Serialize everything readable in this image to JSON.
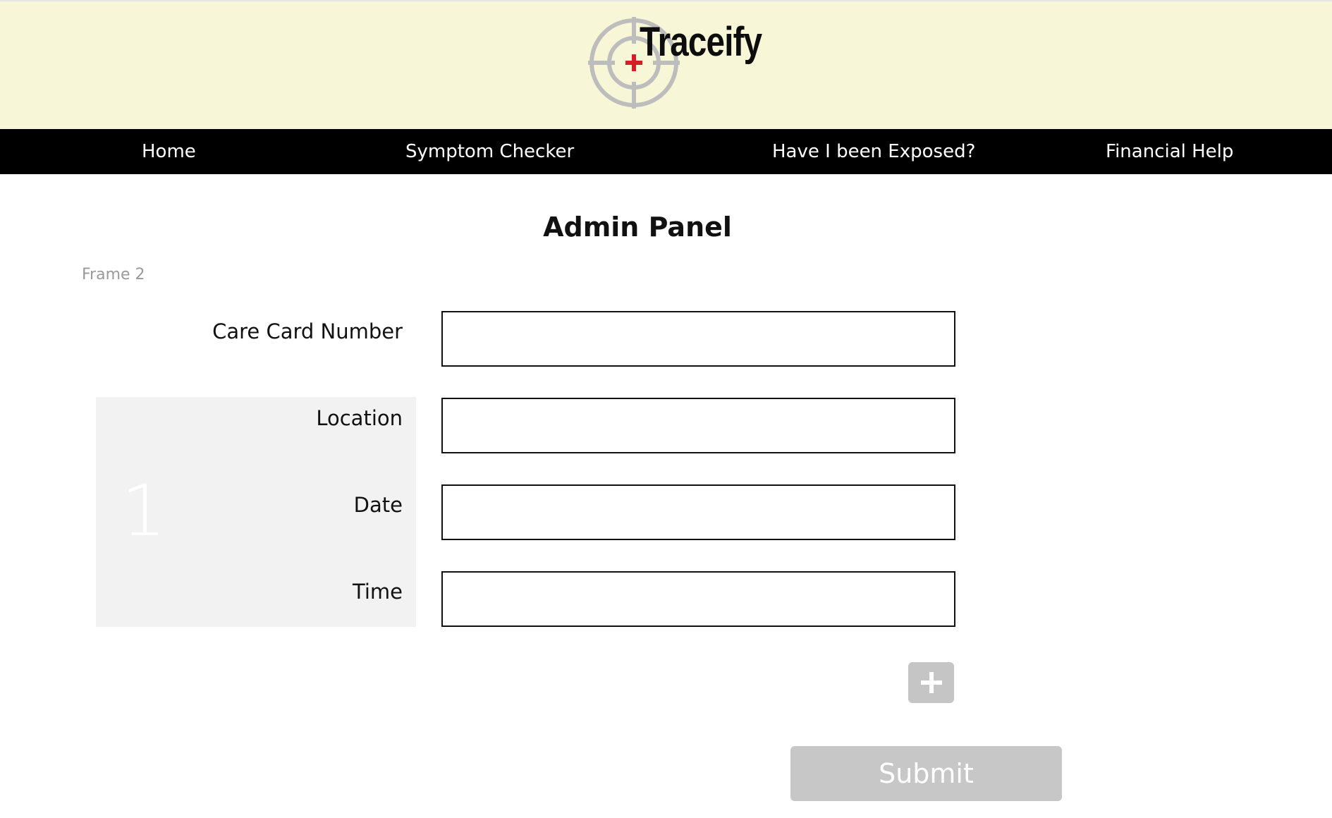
{
  "header": {
    "brand_name": "Traceify",
    "logo_icon": "crosshair-icon",
    "accent_color": "#d32027",
    "background_color": "#f7f7d7"
  },
  "nav": {
    "items": [
      {
        "label": "Home"
      },
      {
        "label": "Symptom Checker"
      },
      {
        "label": "Have I been Exposed?"
      },
      {
        "label": "Financial Help"
      }
    ]
  },
  "main": {
    "title": "Admin Panel",
    "frame_label": "Frame 2",
    "group_number": "1",
    "fields": {
      "care_card": {
        "label": "Care Card Number",
        "value": ""
      },
      "location": {
        "label": "Location",
        "value": ""
      },
      "date": {
        "label": "Date",
        "value": ""
      },
      "time": {
        "label": "Time",
        "value": ""
      }
    },
    "add_icon": "plus-icon",
    "submit_label": "Submit"
  }
}
